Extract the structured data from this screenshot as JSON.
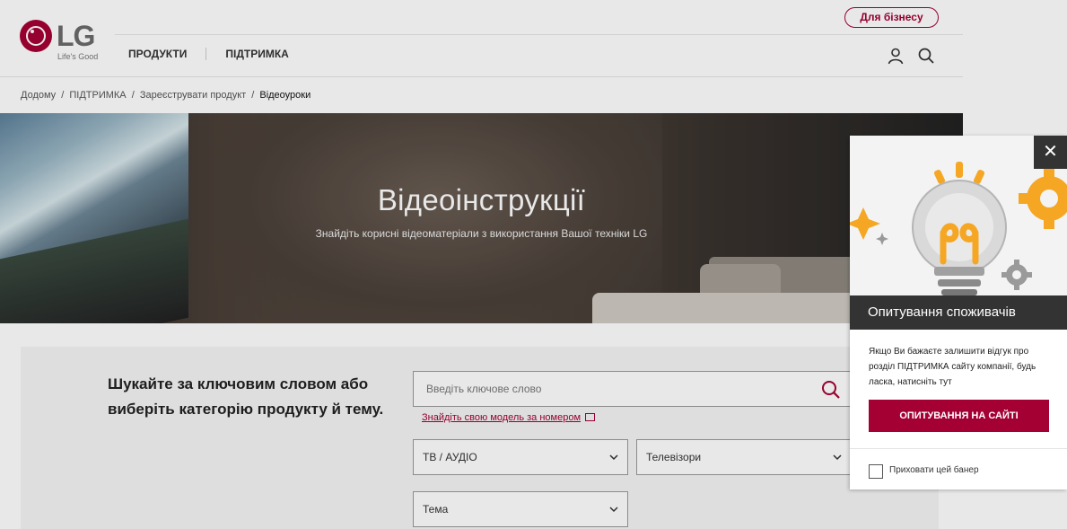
{
  "header": {
    "logo_text": "LG",
    "logo_tagline": "Life's Good",
    "business_button": "Для бізнесу",
    "nav": [
      "ПРОДУКТИ",
      "ПІДТРИМКА"
    ],
    "icons": [
      "user-icon",
      "search-icon"
    ]
  },
  "breadcrumb": {
    "items": [
      "Додому",
      "ПІДТРИМКА",
      "Зареєструвати продукт",
      "Відеоуроки"
    ],
    "separator": "/"
  },
  "hero": {
    "title": "Відеоінструкції",
    "subtitle": "Знайдіть корисні відеоматеріали з використання Вашої техніки LG"
  },
  "search": {
    "heading": "Шукайте за ключовим словом або виберіть категорію продукту й тему.",
    "placeholder": "Введіть ключове слово",
    "find_model_link": "Знайдіть свою модель за номером",
    "category_select": "ТВ / АУДІО",
    "subcategory_select": "Телевізори",
    "topic_select": "Тема"
  },
  "survey_popup": {
    "close_label": "✕",
    "title": "Опитування споживачів",
    "text": "Якщо Ви бажаєте залишити відгук про розділ ПІДТРИМКА сайту компанії, будь ласка, натисніть тут",
    "button": "ОПИТУВАННЯ НА САЙТІ",
    "hide_label": "Приховати цей банер",
    "hide_checked": false
  },
  "colors": {
    "brand": "#a50034",
    "popup_dark": "#333333"
  }
}
